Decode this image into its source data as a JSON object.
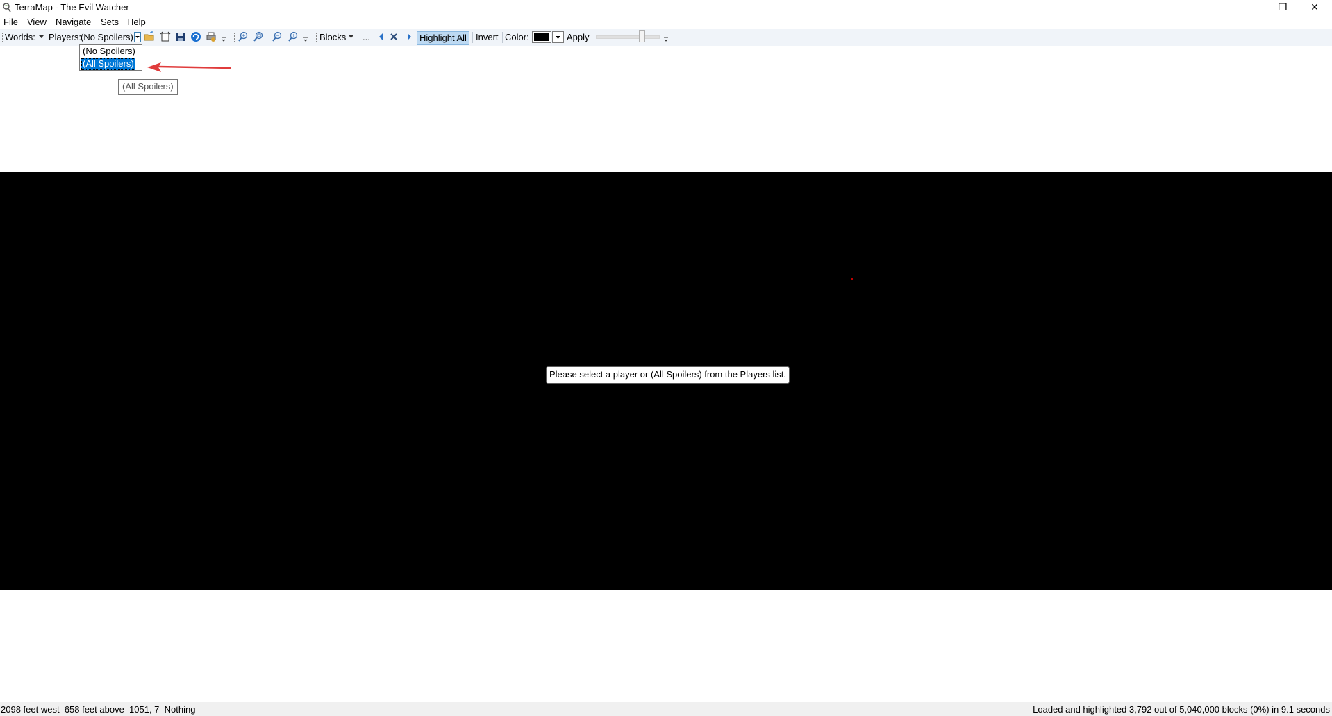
{
  "window": {
    "title": "TerraMap - The Evil Watcher",
    "minimize_glyph": "—",
    "maximize_glyph": "❐",
    "close_glyph": "✕"
  },
  "menu": [
    "File",
    "View",
    "Navigate",
    "Sets",
    "Help"
  ],
  "toolbar": {
    "worlds_label": "Worlds:",
    "players_label": "Players:",
    "players_value": "(No Spoilers)",
    "blocks_label": "Blocks",
    "ellipsis": "...",
    "highlight_all": "Highlight All",
    "invert": "Invert",
    "color_label": "Color:",
    "color_value": "#000000",
    "apply": "Apply"
  },
  "players_dropdown": {
    "options": [
      "(No Spoilers)",
      "(All Spoilers)"
    ],
    "selected_index": 1
  },
  "tooltip": "(All Spoilers)",
  "map": {
    "message": "Please select a player or (All Spoilers) from the Players list."
  },
  "status": {
    "position": "2098 feet west  658 feet above  1051, 7  Nothing",
    "load_info": "Loaded and highlighted 3,792 out of 5,040,000 blocks (0%) in 9.1 seconds"
  },
  "colors": {
    "accent": "#0078d7",
    "annotation_arrow": "#e03c3c",
    "map_background": "#000000"
  }
}
